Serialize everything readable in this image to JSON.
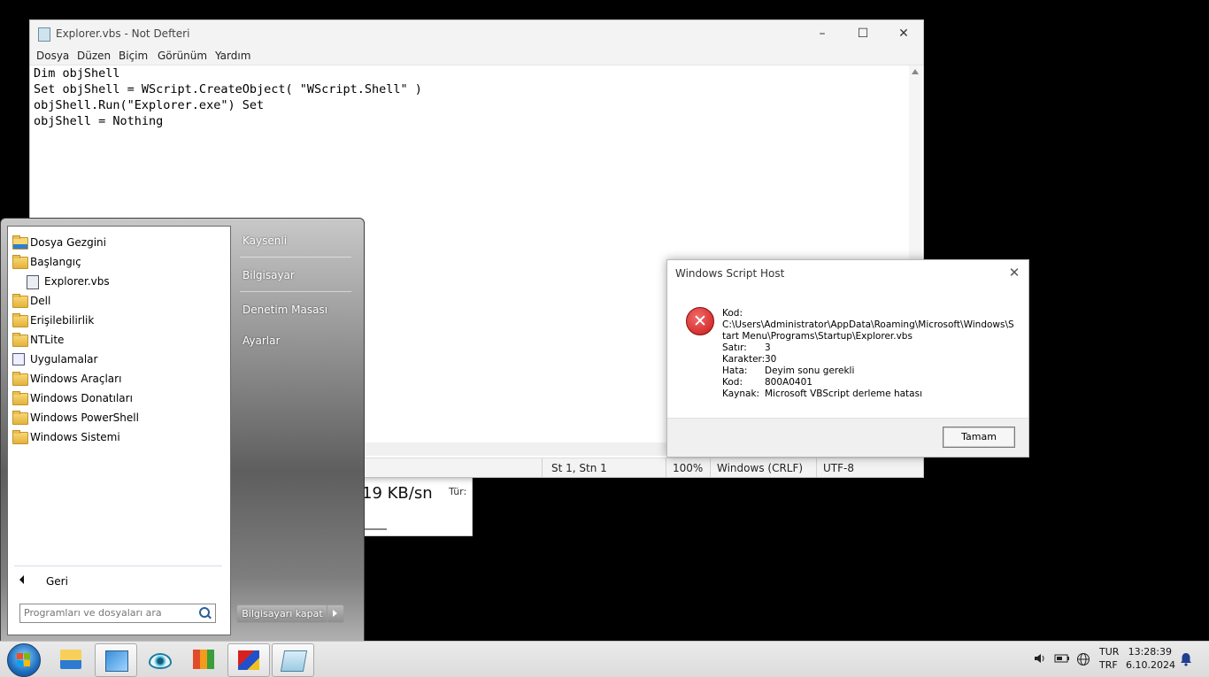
{
  "background_window": {
    "speed": "19 KB/sn",
    "type_label": "Tür:"
  },
  "notepad": {
    "title": "Explorer.vbs - Not Defteri",
    "menu": [
      "Dosya",
      "Düzen",
      "Biçim",
      "Görünüm",
      "Yardım"
    ],
    "content": "Dim objShell\nSet objShell = WScript.CreateObject( \"WScript.Shell\" )\nobjShell.Run(\"Explorer.exe\") Set\nobjShell = Nothing",
    "status": {
      "position": "St 1, Stn 1",
      "zoom": "100%",
      "line_ending": "Windows (CRLF)",
      "encoding": "UTF-8"
    }
  },
  "dialog": {
    "title": "Windows Script Host",
    "script_label": "Kod:",
    "script_path": "C:\\Users\\Administrator\\AppData\\Roaming\\Microsoft\\Windows\\Start Menu\\Programs\\Startup\\Explorer.vbs",
    "rows": [
      {
        "k": "Satır:",
        "v": "3"
      },
      {
        "k": "Karakter:",
        "v": "30"
      },
      {
        "k": "Hata:",
        "v": "Deyim sonu gerekli"
      },
      {
        "k": "Kod:",
        "v": "800A0401"
      },
      {
        "k": "Kaynak:",
        "v": "Microsoft VBScript derleme hatası"
      }
    ],
    "ok_label": "Tamam"
  },
  "start_menu": {
    "items": [
      {
        "label": "Dosya Gezgini",
        "icon": "file-explorer-icon"
      },
      {
        "label": "Başlangıç",
        "icon": "folder-icon"
      },
      {
        "label": "Explorer.vbs",
        "icon": "vbs-script-icon",
        "indent": true
      },
      {
        "label": "Dell",
        "icon": "folder-icon"
      },
      {
        "label": "Erişilebilirlik",
        "icon": "folder-icon"
      },
      {
        "label": "NTLite",
        "icon": "folder-icon"
      },
      {
        "label": "Uygulamalar",
        "icon": "apps-icon"
      },
      {
        "label": "Windows Araçları",
        "icon": "folder-icon"
      },
      {
        "label": "Windows Donatıları",
        "icon": "folder-icon"
      },
      {
        "label": "Windows PowerShell",
        "icon": "folder-icon"
      },
      {
        "label": "Windows Sistemi",
        "icon": "folder-icon"
      }
    ],
    "back_label": "Geri",
    "search_placeholder": "Programları ve dosyaları ara",
    "right_items": [
      "Kaysenli",
      "Bilgisayar",
      "Denetim Masası",
      "Ayarlar"
    ],
    "shutdown_label": "Bilgisayarı kapat"
  },
  "taskbar": {
    "apps": [
      "file-explorer-icon",
      "photos-icon",
      "eye-app-icon",
      "chart-app-icon",
      "installer-app-icon",
      "notepad-icon"
    ],
    "language": {
      "top": "TUR",
      "bottom": "TRF"
    },
    "time": "13:28:39",
    "date": "6.10.2024"
  },
  "colors": {
    "start_orb": "#1d6fbf",
    "error_icon": "#c81818",
    "folder": "#e3b23c"
  }
}
